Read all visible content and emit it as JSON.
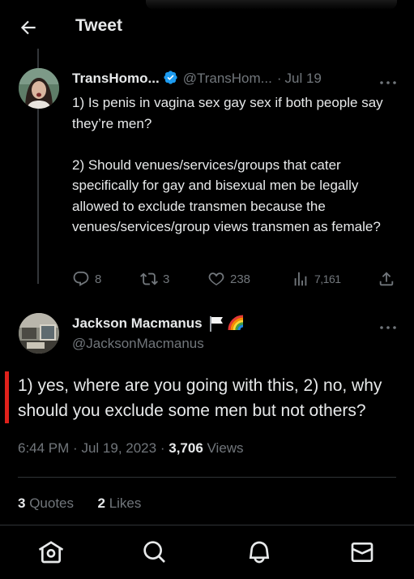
{
  "header": {
    "title": "Tweet",
    "back_icon": "arrow-left-icon"
  },
  "quoted_tweet": {
    "display_name": "TransHomo...",
    "handle": "@TransHom...",
    "separator": "·",
    "date": "Jul 19",
    "verified_icon": "verified-badge-icon",
    "text": "1) Is penis in vagina sex gay sex if both people say they’re men?\n\n2) Should venues/services/groups that cater specifically for gay and bisexual men be legally allowed to exclude transmen because the venues/services/group views transmen as female?",
    "actions": {
      "replies": "8",
      "retweets": "3",
      "likes": "238",
      "views": "7,161"
    }
  },
  "reply": {
    "display_name": "Jackson Macmanus",
    "handle": "@JacksonMacmanus",
    "emoji_flags": [
      "white-flag-icon",
      "rainbow-icon"
    ],
    "text": "1) yes, where are you going with this, 2) no, why should you exclude some men but not others?",
    "time": "6:44 PM",
    "date": "Jul 19, 2023",
    "separator": "·",
    "views_count": "3,706",
    "views_label": "Views",
    "quotes_count": "3",
    "quotes_label": "Quotes",
    "likes_count": "2",
    "likes_label": "Likes"
  },
  "bottom_nav": [
    "home-icon",
    "search-icon",
    "notifications-icon",
    "messages-icon"
  ],
  "colors": {
    "background": "#000000",
    "text": "#e7e9ea",
    "secondary": "#71767b",
    "verified": "#1d9bf0",
    "quote_bar": "#e0211b",
    "divider": "#2f3336"
  }
}
